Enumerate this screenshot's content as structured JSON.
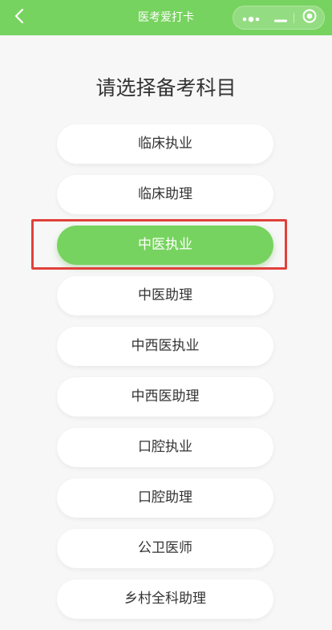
{
  "nav": {
    "title": "医考爱打卡"
  },
  "page": {
    "heading": "请选择备考科目"
  },
  "subjects": [
    {
      "label": "临床执业",
      "selected": false
    },
    {
      "label": "临床助理",
      "selected": false
    },
    {
      "label": "中医执业",
      "selected": true
    },
    {
      "label": "中医助理",
      "selected": false
    },
    {
      "label": "中西医执业",
      "selected": false
    },
    {
      "label": "中西医助理",
      "selected": false
    },
    {
      "label": "口腔执业",
      "selected": false
    },
    {
      "label": "口腔助理",
      "selected": false
    },
    {
      "label": "公卫医师",
      "selected": false
    },
    {
      "label": "乡村全科助理",
      "selected": false
    }
  ],
  "colors": {
    "brand_green": "#77d35f",
    "background": "#f7f7f7",
    "highlight_red": "#e0413b",
    "text_dark": "#333333"
  },
  "icons": {
    "back": "chevron-left-icon",
    "more": "more-dots-icon",
    "minimize": "minimize-icon",
    "close": "target-close-icon"
  }
}
